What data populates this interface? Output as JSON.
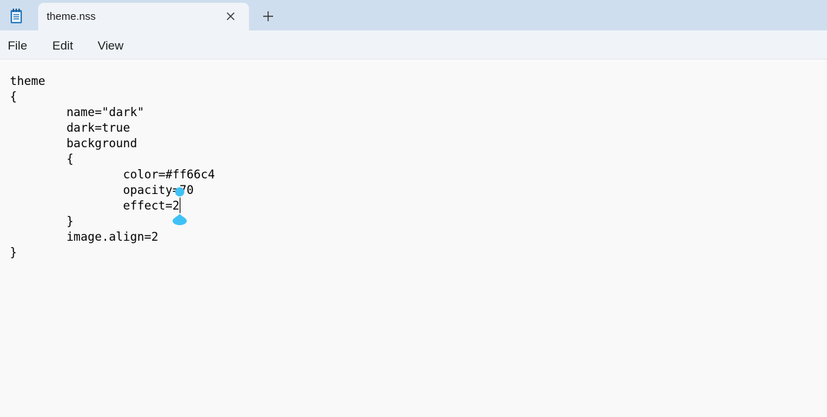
{
  "tab": {
    "title": "theme.nss"
  },
  "icons": {
    "app": "notepad-icon",
    "close": "close-icon",
    "new_tab": "plus-icon"
  },
  "menu": {
    "file": "File",
    "edit": "Edit",
    "view": "View"
  },
  "editor": {
    "lines": [
      "theme",
      "{",
      "\tname=\"dark\"",
      "\tdark=true",
      "\tbackground",
      "\t{",
      "\t\tcolor=#ff66c4",
      "\t\topacity=70",
      "\t\teffect=2",
      "\t}",
      "\timage.align=2",
      "}"
    ]
  },
  "colors": {
    "titlebar": "#cfdeee",
    "tab": "#f0f4f9",
    "editor_bg": "#f9f9f9",
    "handle": "#3fc1f5"
  }
}
